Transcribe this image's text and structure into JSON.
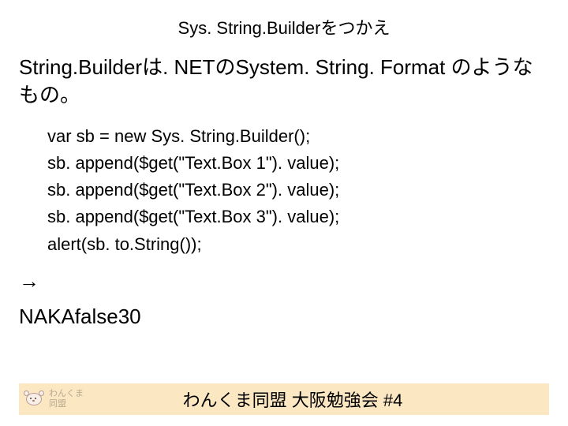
{
  "title": "Sys. String.Builderをつかえ",
  "description": "String.Builderは. NETのSystem. String. Format のようなもの。",
  "code": [
    "var sb = new Sys. String.Builder();",
    "sb. append($get(\"Text.Box 1\"). value);",
    "sb. append($get(\"Text.Box 2\"). value);",
    "sb. append($get(\"Text.Box 3\"). value);",
    "alert(sb. to.String());"
  ],
  "arrow": "→",
  "result": "NAKAfalse30",
  "footer": {
    "logo_line1": "わんくま",
    "logo_line2": "同盟",
    "text": "わんくま同盟 大阪勉強会 #4"
  }
}
